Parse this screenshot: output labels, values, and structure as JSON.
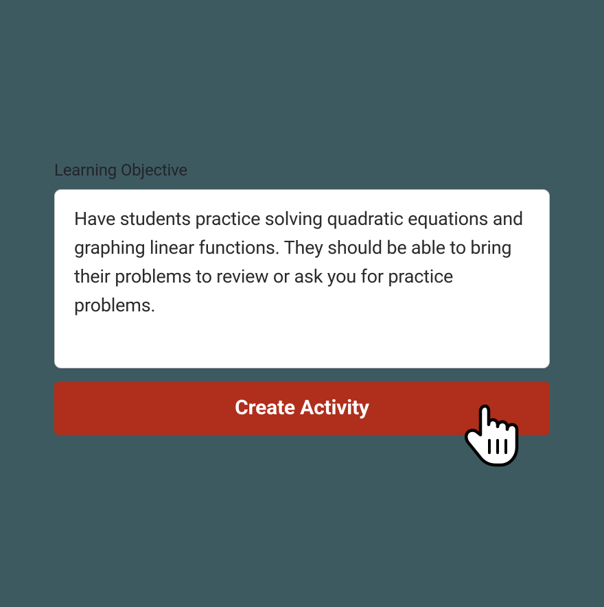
{
  "form": {
    "label": "Learning Objective",
    "value": "Have students practice solving quadratic equations and graphing linear functions. They should be able to bring their problems to review or ask you for practice problems.",
    "button_label": "Create Activity"
  },
  "colors": {
    "background": "#3e5a61",
    "button": "#b02e1c",
    "button_text": "#ffffff",
    "card": "#ffffff"
  }
}
